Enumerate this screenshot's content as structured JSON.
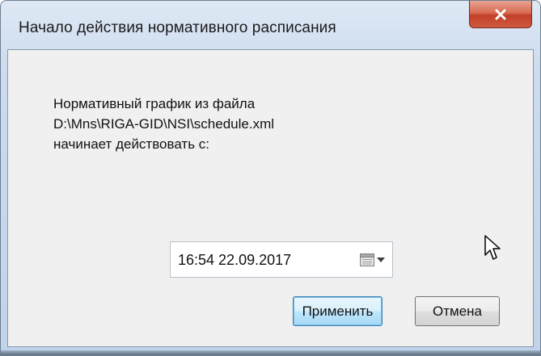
{
  "window": {
    "title": "Начало действия нормативного расписания",
    "close_symbol": "x"
  },
  "message": {
    "line1": "Нормативный график из файла",
    "line2": "D:\\Mns\\RIGA-GID\\NSI\\schedule.xml",
    "line3": "начинает действовать с:"
  },
  "datetime_picker": {
    "value": "16:54 22.09.2017",
    "icon": "calendar-icon",
    "arrow_icon": "chevron-down-icon"
  },
  "buttons": {
    "apply_label": "Применить",
    "cancel_label": "Отмена"
  },
  "colors": {
    "close_button": "#c2402a",
    "default_button_border": "#3c7fb1",
    "client_background": "#f0f0f0"
  }
}
